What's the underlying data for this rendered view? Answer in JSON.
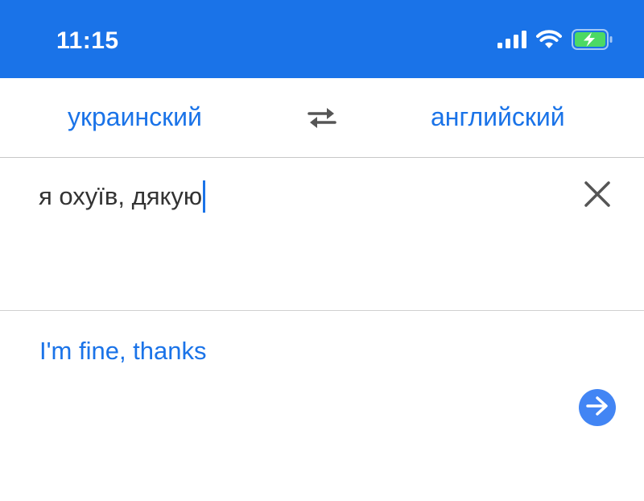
{
  "status_bar": {
    "time": "11:15",
    "icons": [
      "cellular-signal-icon",
      "wifi-icon",
      "battery-charging-icon"
    ],
    "background_color": "#1a73e8",
    "battery_color": "#4cd964"
  },
  "language_bar": {
    "source_language": "украинский",
    "target_language": "английский",
    "swap_icon": "swap-arrows-icon"
  },
  "input": {
    "text": "я охуїв, дякую",
    "clear_icon": "close-icon"
  },
  "output": {
    "translation": "I'm fine, thanks",
    "action_icon": "arrow-right-icon"
  },
  "colors": {
    "accent": "#1a73e8",
    "button": "#4285f4",
    "text": "#333333",
    "divider": "#c8c8c8"
  }
}
